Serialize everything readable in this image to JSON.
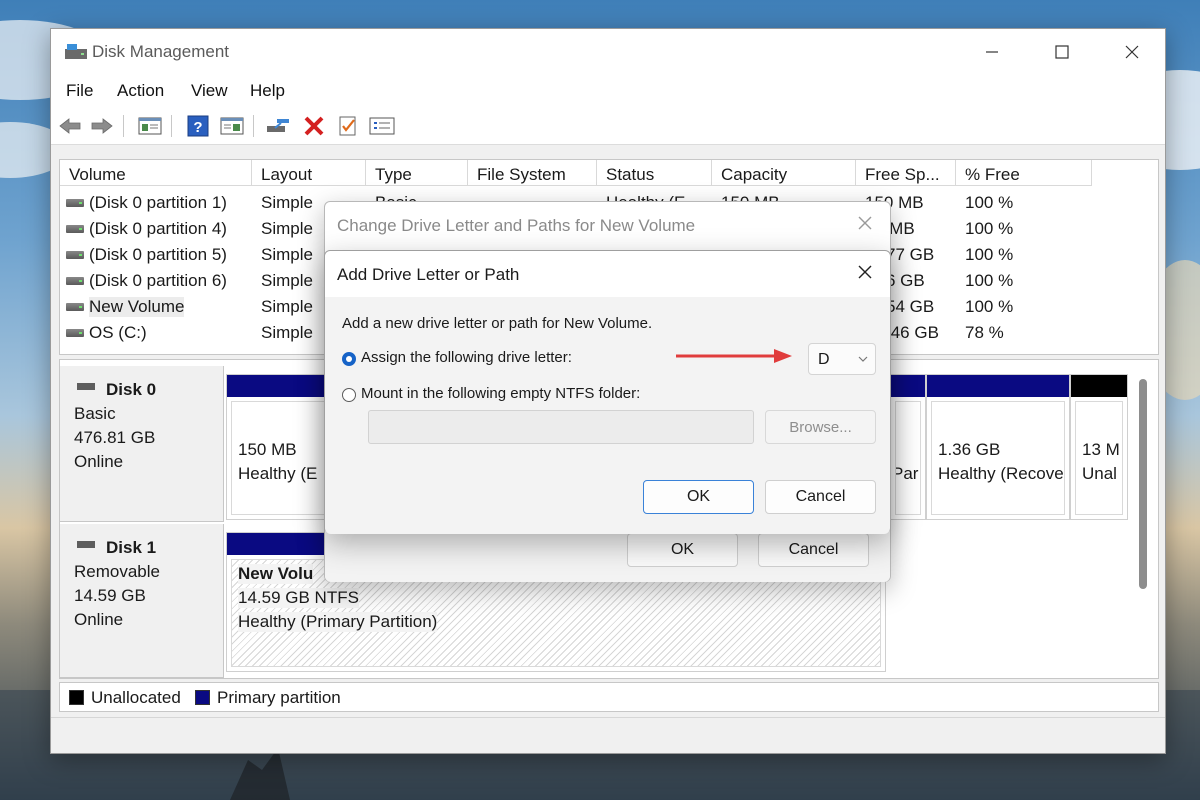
{
  "window": {
    "title": "Disk Management"
  },
  "menu": [
    "File",
    "Action",
    "View",
    "Help"
  ],
  "toolbar": {
    "icons": [
      "back-arrow-icon",
      "forward-arrow-icon",
      "properties-pane-icon",
      "help-icon",
      "view-pane-icon",
      "connect-drive-icon",
      "delete-icon",
      "check-icon",
      "settings-list-icon"
    ]
  },
  "volume_list": {
    "columns": [
      "Volume",
      "Layout",
      "Type",
      "File System",
      "Status",
      "Capacity",
      "Free Sp...",
      "% Free"
    ],
    "rows": [
      {
        "volume": "(Disk 0 partition 1)",
        "layout": "Simple",
        "type": "Basic",
        "fs": "",
        "status": "Healthy (E",
        "capacity": "150 MB",
        "free": "150 MB",
        "pct": "100 %"
      },
      {
        "volume": "(Disk 0 partition 4)",
        "layout": "Simple",
        "type": "",
        "fs": "",
        "status": "",
        "capacity": "",
        "free": "0 MB",
        "pct": "100 %"
      },
      {
        "volume": "(Disk 0 partition 5)",
        "layout": "Simple",
        "type": "",
        "fs": "",
        "status": "",
        "capacity": "",
        "free": "77 GB",
        "pct": "100 %"
      },
      {
        "volume": "(Disk 0 partition 6)",
        "layout": "Simple",
        "type": "",
        "fs": "",
        "status": "",
        "capacity": "",
        "free": "6 GB",
        "pct": "100 %"
      },
      {
        "volume": "New Volume",
        "layout": "Simple",
        "type": "",
        "fs": "",
        "status": "",
        "capacity": "",
        "free": "54 GB",
        "pct": "100 %"
      },
      {
        "volume": "OS (C:)",
        "layout": "Simple",
        "type": "",
        "fs": "",
        "status": "",
        "capacity": "",
        "free": ".46 GB",
        "pct": "78 %"
      }
    ]
  },
  "disks": [
    {
      "name": "Disk 0",
      "type": "Basic",
      "size": "476.81 GB",
      "state": "Online",
      "partitions": [
        {
          "size": "150 MB",
          "status": "Healthy (E"
        },
        {
          "size": "",
          "status": "Par"
        },
        {
          "size": "1.36 GB",
          "status": "Healthy (Recove"
        },
        {
          "size": "13 M",
          "status": "Unal"
        }
      ]
    },
    {
      "name": "Disk 1",
      "type": "Removable",
      "size": "14.59 GB",
      "state": "Online",
      "partitions": [
        {
          "name": "New Volu",
          "size": "14.59 GB NTFS",
          "status": "Healthy (Primary Partition)"
        }
      ]
    }
  ],
  "legend": [
    {
      "label": "Unallocated",
      "color": "#000000"
    },
    {
      "label": "Primary partition",
      "color": "#0a0a82"
    }
  ],
  "dialog_back": {
    "title": "Change Drive Letter and Paths for New Volume",
    "ok_label": "OK",
    "cancel_label": "Cancel"
  },
  "dialog_front": {
    "title": "Add Drive Letter or Path",
    "instruction": "Add a new drive letter or path for New Volume.",
    "option_assign": "Assign the following drive letter:",
    "option_mount": "Mount in the following empty NTFS folder:",
    "drive_letter": "D",
    "browse_label": "Browse...",
    "ok_label": "OK",
    "cancel_label": "Cancel"
  },
  "colors": {
    "accent": "#1663c7",
    "annotation_arrow": "#e03c3c",
    "primary_partition": "#0a0a82"
  }
}
